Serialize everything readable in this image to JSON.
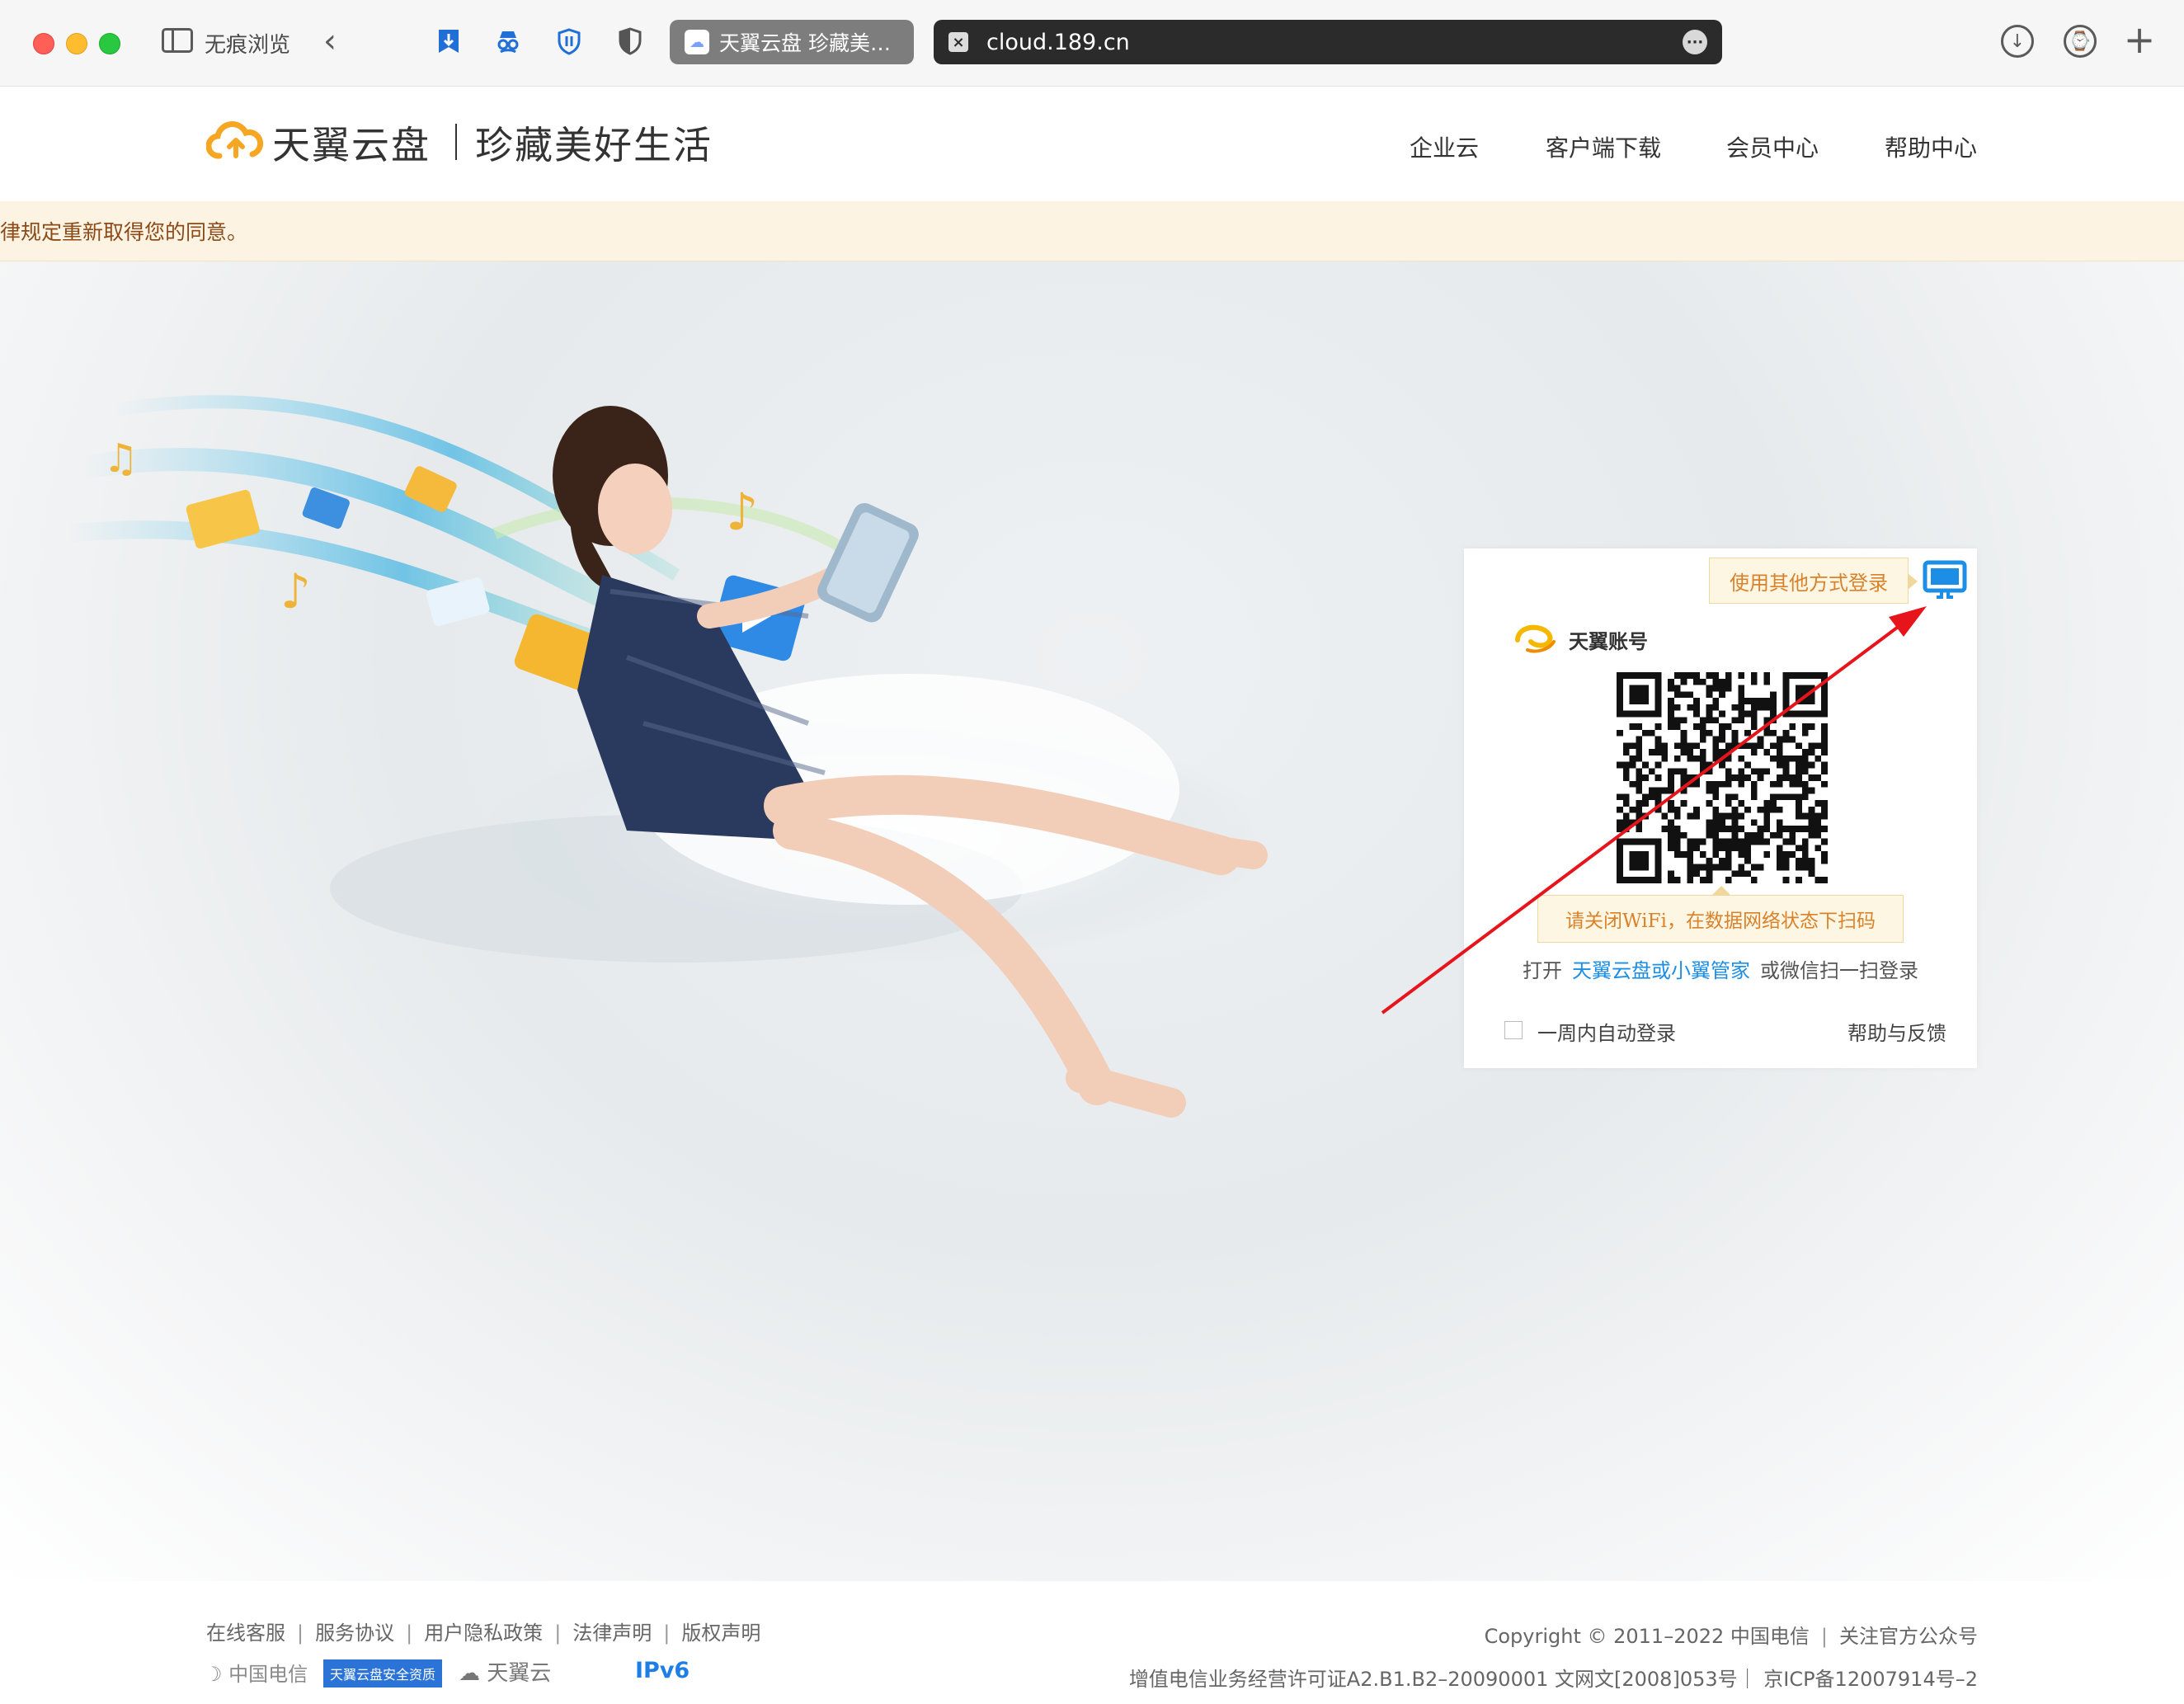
{
  "browser": {
    "private_label": "无痕浏览",
    "tab1_title": "天翼云盘 珍藏美…",
    "address": "cloud.189.cn"
  },
  "header": {
    "brand": "天翼云盘",
    "slogan": "珍藏美好生活",
    "nav": [
      "企业云",
      "客户端下载",
      "会员中心",
      "帮助中心"
    ]
  },
  "notice": {
    "text": "律规定重新取得您的同意。"
  },
  "login": {
    "other_login_tip": "使用其他方式登录",
    "account_brand": "天翼账号",
    "scan_tip": "请关闭WiFi，在数据网络状态下扫码",
    "open_prefix": "打开",
    "open_link": "天翼云盘或小翼管家",
    "open_suffix": "或微信扫一扫登录",
    "auto_login": "一周内自动登录",
    "help_feedback": "帮助与反馈"
  },
  "footer": {
    "links": [
      "在线客服",
      "服务协议",
      "用户隐私政策",
      "法律声明",
      "版权声明"
    ],
    "copyright": "Copyright © 2011–2022 中国电信",
    "follow": "关注官方公众号",
    "license": "增值电信业务经营许可证A2.B1.B2–20090001 文网文[2008]053号｜ 京ICP备12007914号–2",
    "badges": {
      "china_telecom": "中国电信",
      "safe": "天翼云盘安全资质",
      "ecloud": "天翼云",
      "ipv6": "IPv6"
    }
  },
  "colors": {
    "accent_orange": "#f5a623",
    "link_blue": "#1d8ee6",
    "notice_bg": "#fdf3e2",
    "annotation_red": "#e8141b"
  }
}
